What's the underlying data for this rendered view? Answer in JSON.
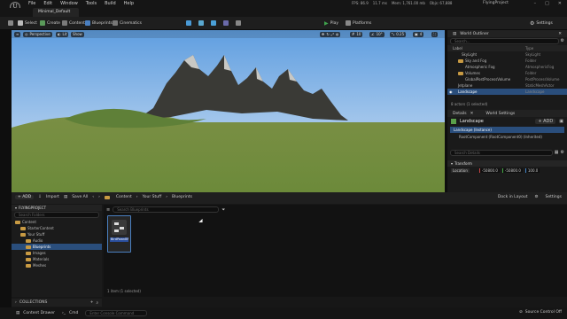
{
  "menubar": {
    "logo": "U",
    "items": [
      "File",
      "Edit",
      "Window",
      "Tools",
      "Build",
      "Help"
    ],
    "stats": [
      "FPS: 86.9",
      "11.7 ms",
      "Mem: 1,761.00 mb",
      "Objs: 67,888"
    ],
    "project": "FlyingProject",
    "window_controls": [
      "–",
      "□",
      "✕"
    ]
  },
  "level_tab": "Minimal_Default",
  "toolbar": {
    "save": "",
    "mode": "Select",
    "create": "Create",
    "content": "Content",
    "blueprints": "Blueprints",
    "cinematics": "Cinematics",
    "play": "Play",
    "platforms": "Platforms",
    "settings": "Settings"
  },
  "viewport": {
    "perspective": "Perspective",
    "lit": "Lit",
    "show": "Show",
    "right_controls": [
      "10",
      "10°",
      "0.25",
      "4"
    ]
  },
  "outliner": {
    "title": "World Outliner",
    "search_placeholder": "Search...",
    "col_label": "Label",
    "col_type": "Type",
    "rows": [
      {
        "label": "SkyLight",
        "type": "SkyLight"
      },
      {
        "label": "Sky and Fog",
        "type": "Folder"
      },
      {
        "label": "Atmospheric Fog",
        "type": "AtmosphericFog"
      },
      {
        "label": "Volumes",
        "type": "Folder"
      },
      {
        "label": "GlobalPostProcessVolume",
        "type": "PostProcessVolume"
      },
      {
        "label": "Jetplane",
        "type": "StaticMeshActor"
      },
      {
        "label": "Landscape",
        "type": "Landscape"
      }
    ],
    "footer": "8 actors (1 selected)"
  },
  "details": {
    "tab_details": "Details",
    "tab_world": "World Settings",
    "selected": "Landscape",
    "add": "+ ADD",
    "instance": "Landscape (Instance)",
    "root_component": "RootComponent (RootComponent0) (Inherited)",
    "search_placeholder": "Search Details",
    "transform_label": "Transform",
    "location_label": "Location",
    "location": [
      "-50800.0",
      "-50800.0",
      "100.0"
    ]
  },
  "content_browser": {
    "add": "+ ADD",
    "import": "Import",
    "save_all": "Save All",
    "breadcrumb": [
      "Content",
      "Your Stuff",
      "Blueprints"
    ],
    "dock": "Dock in Layout",
    "settings": "Settings",
    "search_placeholder": "Search Blueprints",
    "search_folders_placeholder": "Search Folders",
    "project_root": "FLYINGPROJECT",
    "tree": [
      {
        "label": "Content",
        "depth": 0,
        "selected": false
      },
      {
        "label": "StarterContent",
        "depth": 1,
        "selected": false
      },
      {
        "label": "Your Stuff",
        "depth": 1,
        "selected": false
      },
      {
        "label": "Audio",
        "depth": 2,
        "selected": false
      },
      {
        "label": "Blueprints",
        "depth": 2,
        "selected": true
      },
      {
        "label": "Images",
        "depth": 2,
        "selected": false
      },
      {
        "label": "Materials",
        "depth": 2,
        "selected": false
      },
      {
        "label": "Meshes",
        "depth": 2,
        "selected": false
      }
    ],
    "asset_name": "BirdPawnBP",
    "item_count": "1 item (1 selected)",
    "collections": "COLLECTIONS"
  },
  "statusbar": {
    "content_drawer": "Content Drawer",
    "cmd": "Cmd",
    "console_placeholder": "Enter Console Command",
    "source_control": "Source Control Off"
  },
  "colors": {
    "accent": "#2a4e7c",
    "folder": "#c89a43",
    "play_green": "#3fa34d"
  }
}
